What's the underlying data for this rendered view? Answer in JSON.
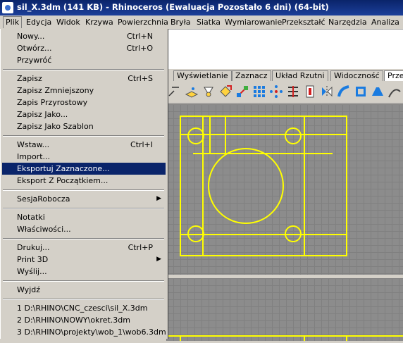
{
  "window": {
    "title": "sil_X.3dm (141 KB) - Rhinoceros (Ewaluacja Pozostało 6 dni) (64-bit)"
  },
  "menubar": [
    "Plik",
    "Edycja",
    "Widok",
    "Krzywa",
    "Powierzchnia",
    "Bryła",
    "Siatka",
    "Wymiarowanie",
    "Przekształć",
    "Narzędzia",
    "Analiza"
  ],
  "tabs": [
    "Wyświetlanie",
    "Zaznacz",
    "Układ Rzutni",
    "Widoczność",
    "Prze"
  ],
  "file_menu": {
    "new": {
      "label": "Nowy...",
      "shortcut": "Ctrl+N"
    },
    "open": {
      "label": "Otwórz...",
      "shortcut": "Ctrl+O"
    },
    "revert": {
      "label": "Przywróć"
    },
    "save": {
      "label": "Zapisz",
      "shortcut": "Ctrl+S"
    },
    "save_small": {
      "label": "Zapisz Zmniejszony"
    },
    "save_incremental": {
      "label": "Zapis Przyrostowy"
    },
    "save_as": {
      "label": "Zapisz Jako..."
    },
    "save_template": {
      "label": "Zapisz Jako Szablon"
    },
    "insert": {
      "label": "Wstaw...",
      "shortcut": "Ctrl+I"
    },
    "import": {
      "label": "Import..."
    },
    "export_selected": {
      "label": "Eksportuj Zaznaczone..."
    },
    "export_origin": {
      "label": "Eksport Z Początkiem..."
    },
    "worksession": {
      "label": "SesjaRobocza"
    },
    "notes": {
      "label": "Notatki"
    },
    "properties": {
      "label": "Właściwości..."
    },
    "print": {
      "label": "Drukuj...",
      "shortcut": "Ctrl+P"
    },
    "print3d": {
      "label": "Print 3D"
    },
    "send": {
      "label": "Wyślij..."
    },
    "exit": {
      "label": "Wyjdź"
    },
    "recent": [
      "1 D:\\RHINO\\CNC_czesci\\sil_X.3dm",
      "2 D:\\RHINO\\NOWY\\okret.3dm",
      "3 D:\\RHINO\\projekty\\wob_1\\wob6.3dm"
    ]
  },
  "colors": {
    "highlight": "#0a246a",
    "drawing": "#ffff00",
    "viewport_bg": "#8c8c8c"
  }
}
